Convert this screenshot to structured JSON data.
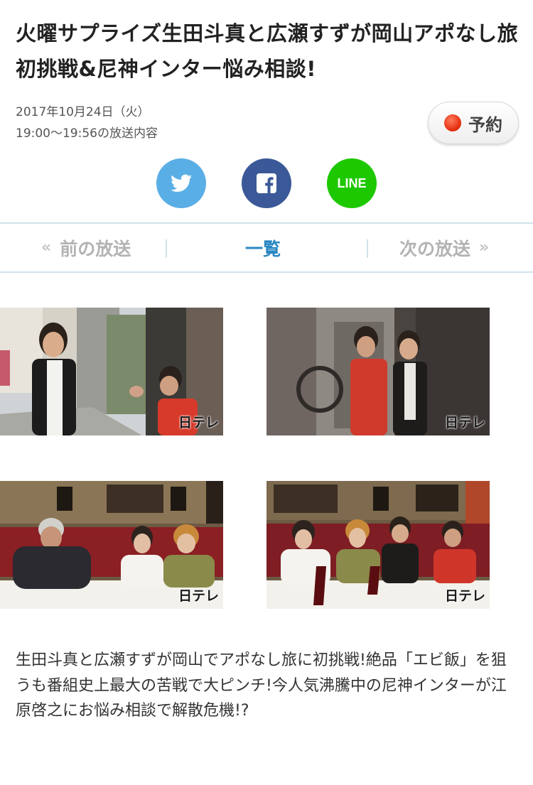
{
  "program": {
    "title": "火曜サプライズ生田斗真と広瀬すずが岡山アポなし旅初挑戦&尼神インター悩み相談!",
    "air_date": "2017年10月24日（火）",
    "air_time": "19:00〜19:56の放送内容",
    "reserve_label": "予約",
    "description": "生田斗真と広瀬すずが岡山でアポなし旅に初挑戦!絶品「エビ飯」を狙うも番組史上最大の苦戦で大ピンチ!今人気沸騰中の尼神インターが江原啓之にお悩み相談で解散危機!?"
  },
  "share": {
    "line_label": "LINE"
  },
  "nav": {
    "prev_label": "前の放送",
    "list_label": "一覧",
    "next_label": "次の放送"
  },
  "thumbnails": {
    "watermark": "日テレ"
  },
  "colors": {
    "twitter": "#5aaee6",
    "facebook": "#3b5998",
    "line": "#1ec800",
    "nav_active": "#2a87c2",
    "record_dot": "#e22a0a"
  }
}
